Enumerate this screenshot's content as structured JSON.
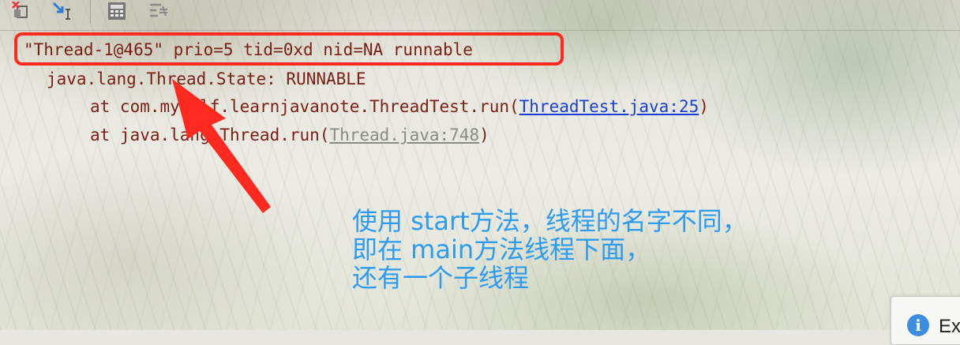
{
  "toolbar": {
    "icons": [
      "restore-layout-icon",
      "step-into-icon",
      "calculator-icon",
      "settings-icon"
    ]
  },
  "console": {
    "thread_header": "\"Thread-1@465\" prio=5 tid=0xd nid=NA runnable",
    "state_line": "java.lang.Thread.State: RUNNABLE",
    "frame1_prefix": "at com.myself.learnjavanote.ThreadTest.run(",
    "frame1_link": "ThreadTest.java:25",
    "frame1_suffix": ")",
    "frame2_prefix": "at java.lang.Thread.run(",
    "frame2_link": "Thread.java:748",
    "frame2_suffix": ")"
  },
  "annotation": {
    "line1": "使用 start方法，线程的名字不同，",
    "line2": "即在 main方法线程下面，",
    "line3": "还有一个子线程",
    "color": "#2d9bf0",
    "highlight_color": "#ff2a1f"
  },
  "notification": {
    "icon": "info-icon",
    "text": "Ex"
  }
}
